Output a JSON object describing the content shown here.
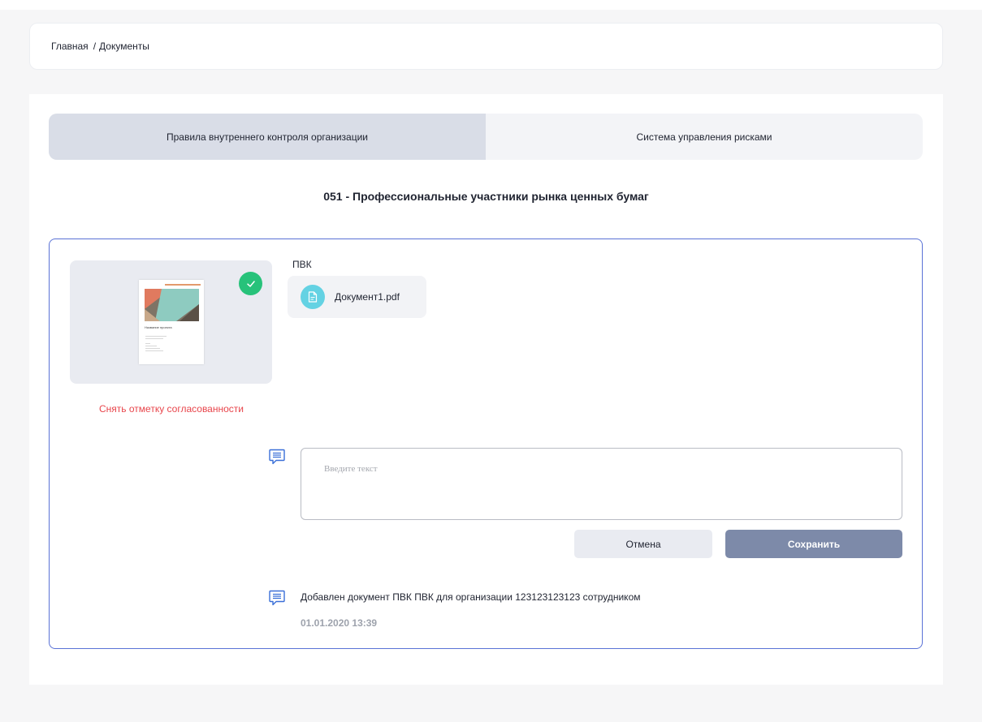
{
  "breadcrumb": {
    "home": "Главная",
    "separator": "/",
    "current": "Документы"
  },
  "tabs": [
    {
      "label": "Правила внутреннего контроля организации",
      "active": true
    },
    {
      "label": "Система управления рисками",
      "active": false
    }
  ],
  "section": {
    "title": "051 - Профессиональные участники рынка ценных бумаг"
  },
  "document": {
    "label": "ПВК",
    "file_name": "Документ1.pdf",
    "file_icon": "document-icon",
    "approved": true,
    "approved_icon": "check-icon",
    "thumbnail_title": "Название проекта",
    "unmark_link": "Снять отметку согласованности"
  },
  "comment": {
    "icon": "comment-icon",
    "placeholder": "Введите текст",
    "value": "",
    "cancel_label": "Отмена",
    "save_label": "Сохранить"
  },
  "history": [
    {
      "icon": "comment-icon",
      "text": "Добавлен документ ПВК ПВК для организации 123123123123 сотрудником",
      "date": "01.01.2020 13:39"
    }
  ],
  "colors": {
    "accent_border": "#5a72d6",
    "approved": "#27c27a",
    "danger_link": "#e8454b",
    "save_button": "#7d8aa9",
    "file_icon_bg": "#64d2e3",
    "active_tab": "#d9dde7"
  }
}
